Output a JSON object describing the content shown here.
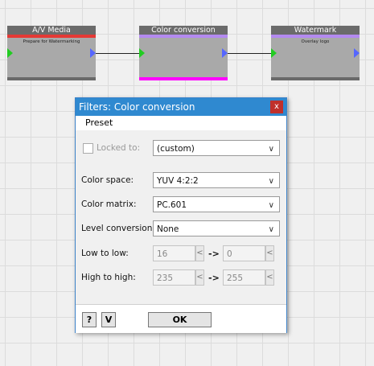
{
  "nodes": [
    {
      "title": "A/V Media",
      "subtitle": "Prepare for Watermarking",
      "bar_color": "#e53935"
    },
    {
      "title": "Color conversion",
      "subtitle": "",
      "bar_color": "#b48af0",
      "bottom_color": "#ff00ff"
    },
    {
      "title": "Watermark",
      "subtitle": "Overlay logo",
      "bar_color": "#b48af0"
    }
  ],
  "dialog": {
    "title": "Filters: Color conversion",
    "close_icon": "close-icon",
    "close_glyph": "x",
    "menu": {
      "preset": "Preset"
    },
    "locked_label": "Locked to:",
    "locked_value": "(custom)",
    "color_space_label": "Color space:",
    "color_space_value": "YUV 4:2:2",
    "color_matrix_label": "Color matrix:",
    "color_matrix_value": "PC.601",
    "level_conversion_label": "Level conversion:",
    "level_conversion_value": "None",
    "low_label": "Low to low:",
    "low_from": "16",
    "low_to": "0",
    "high_label": "High to high:",
    "high_from": "235",
    "high_to": "255",
    "arrow": "->",
    "help_button": "?",
    "v_button": "V",
    "ok_button": "OK"
  },
  "colors": {
    "accent": "#2f89d0",
    "close": "#c0302b",
    "pin_in": "#22cc22",
    "pin_out": "#5566ff"
  }
}
